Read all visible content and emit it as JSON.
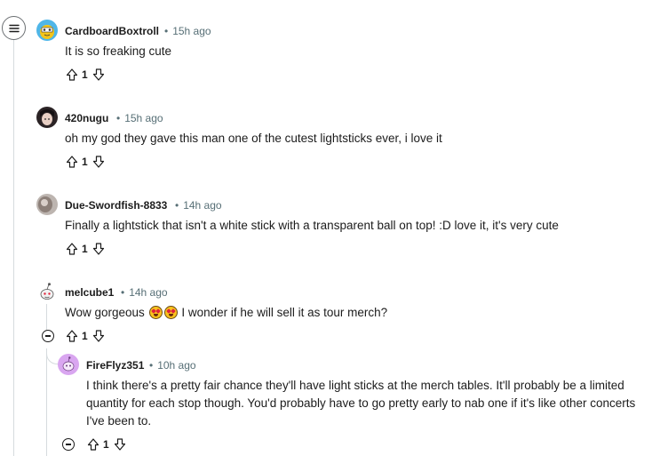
{
  "comments": [
    {
      "author": "CardboardBoxtroll",
      "time": "15h ago",
      "body": "It is so freaking cute",
      "votes": "1",
      "avatar": "yellow-snoo-avatar"
    },
    {
      "author": "420nugu",
      "time": "15h ago",
      "body": "oh my god they gave this man one of the cutest lightsticks ever, i love it",
      "votes": "1",
      "avatar": "photo-avatar"
    },
    {
      "author": "Due-Swordfish-8833",
      "time": "14h ago",
      "body": "Finally a lightstick that isn't a white stick with a transparent ball on top! :D love it, it's very cute",
      "votes": "1",
      "avatar": "grey-photo-avatar"
    },
    {
      "author": "melcube1",
      "time": "14h ago",
      "body_before": "Wow gorgeous",
      "emoji": "heart-eyes-emoji",
      "body_after": "I wonder if he will sell it as tour merch?",
      "votes": "1",
      "avatar": "snoo-avatar"
    },
    {
      "author": "FireFlyz351",
      "time": "10h ago",
      "body": "I think there's a pretty fair chance they'll have light sticks at the merch tables. It'll probably be a limited quantity for each stop though. You'd probably have to go pretty early to nab one if it's like other concerts I've been to.",
      "votes": "1",
      "avatar": "purple-snoo-avatar"
    }
  ]
}
